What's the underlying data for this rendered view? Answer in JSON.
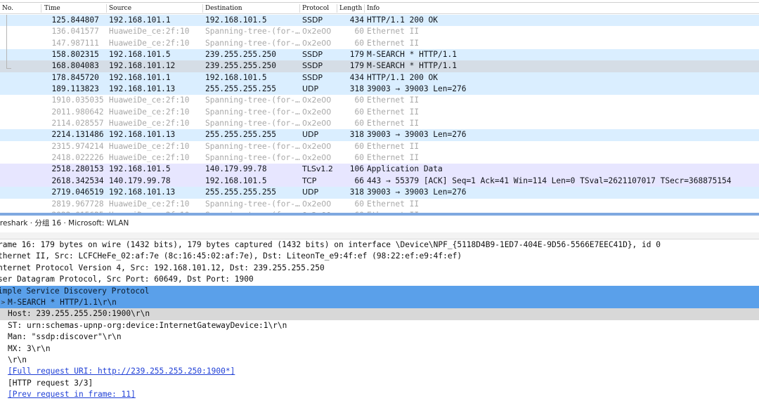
{
  "packet_list": {
    "columns": [
      "No.",
      "Time",
      "Source",
      "Destination",
      "Protocol",
      "Length",
      "Info"
    ],
    "rows": [
      {
        "no": "12",
        "time": "5.844807",
        "src": "192.168.101.1",
        "dst": "192.168.101.5",
        "proto": "SSDP",
        "len": "434",
        "info": "HTTP/1.1 200 OK",
        "kind": "udp"
      },
      {
        "no": "13",
        "time": "6.041577",
        "src": "HuaweiDe_ce:2f:10",
        "dst": "Spanning-tree-(for-…",
        "proto": "0x2e00",
        "len": "60",
        "info": "Ethernet II",
        "kind": "stp"
      },
      {
        "no": "14",
        "time": "7.987111",
        "src": "HuaweiDe_ce:2f:10",
        "dst": "Spanning-tree-(for-…",
        "proto": "0x2e00",
        "len": "60",
        "info": "Ethernet II",
        "kind": "stp"
      },
      {
        "no": "15",
        "time": "8.802315",
        "src": "192.168.101.5",
        "dst": "239.255.255.250",
        "proto": "SSDP",
        "len": "179",
        "info": "M-SEARCH * HTTP/1.1",
        "kind": "udp"
      },
      {
        "no": "16",
        "time": "8.804083",
        "src": "192.168.101.12",
        "dst": "239.255.255.250",
        "proto": "SSDP",
        "len": "179",
        "info": "M-SEARCH * HTTP/1.1",
        "kind": "selected"
      },
      {
        "no": "17",
        "time": "8.845720",
        "src": "192.168.101.1",
        "dst": "192.168.101.5",
        "proto": "SSDP",
        "len": "434",
        "info": "HTTP/1.1 200 OK",
        "kind": "udp"
      },
      {
        "no": "18",
        "time": "9.113823",
        "src": "192.168.101.13",
        "dst": "255.255.255.255",
        "proto": "UDP",
        "len": "318",
        "info": "39003 → 39003 Len=276",
        "kind": "udp"
      },
      {
        "no": "19",
        "time": "10.035035",
        "src": "HuaweiDe_ce:2f:10",
        "dst": "Spanning-tree-(for-…",
        "proto": "0x2e00",
        "len": "60",
        "info": "Ethernet II",
        "kind": "stp"
      },
      {
        "no": "20",
        "time": "11.980642",
        "src": "HuaweiDe_ce:2f:10",
        "dst": "Spanning-tree-(for-…",
        "proto": "0x2e00",
        "len": "60",
        "info": "Ethernet II",
        "kind": "stp"
      },
      {
        "no": "21",
        "time": "14.028557",
        "src": "HuaweiDe_ce:2f:10",
        "dst": "Spanning-tree-(for-…",
        "proto": "0x2e00",
        "len": "60",
        "info": "Ethernet II",
        "kind": "stp"
      },
      {
        "no": "22",
        "time": "14.131486",
        "src": "192.168.101.13",
        "dst": "255.255.255.255",
        "proto": "UDP",
        "len": "318",
        "info": "39003 → 39003 Len=276",
        "kind": "udp"
      },
      {
        "no": "23",
        "time": "15.974214",
        "src": "HuaweiDe_ce:2f:10",
        "dst": "Spanning-tree-(for-…",
        "proto": "0x2e00",
        "len": "60",
        "info": "Ethernet II",
        "kind": "stp"
      },
      {
        "no": "24",
        "time": "18.022226",
        "src": "HuaweiDe_ce:2f:10",
        "dst": "Spanning-tree-(for-…",
        "proto": "0x2e00",
        "len": "60",
        "info": "Ethernet II",
        "kind": "stp"
      },
      {
        "no": "25",
        "time": "18.280153",
        "src": "192.168.101.5",
        "dst": "140.179.99.78",
        "proto": "TLSv1.2",
        "len": "106",
        "info": "Application Data",
        "kind": "tcp"
      },
      {
        "no": "26",
        "time": "18.342534",
        "src": "140.179.99.78",
        "dst": "192.168.101.5",
        "proto": "TCP",
        "len": "66",
        "info": "443 → 55379 [ACK] Seq=1 Ack=41 Win=114 Len=0 TSval=2621107017 TSecr=368875154",
        "kind": "tcp"
      },
      {
        "no": "27",
        "time": "19.046519",
        "src": "192.168.101.13",
        "dst": "255.255.255.255",
        "proto": "UDP",
        "len": "318",
        "info": "39003 → 39003 Len=276",
        "kind": "udp"
      },
      {
        "no": "28",
        "time": "19.967728",
        "src": "HuaweiDe_ce:2f:10",
        "dst": "Spanning-tree-(for-…",
        "proto": "0x2e00",
        "len": "60",
        "info": "Ethernet II",
        "kind": "stp"
      },
      {
        "no": "29",
        "time": "22.015625",
        "src": "HuaweiDe_ce:2f:10",
        "dst": "Spanning-tree-(for-…",
        "proto": "0x2e00",
        "len": "60",
        "info": "Ethernet II",
        "kind": "stp"
      }
    ]
  },
  "detail": {
    "title": "ireshark · 分组 16 · Microsoft: WLAN",
    "lines": [
      {
        "text": "rame 16: 179 bytes on wire (1432 bits), 179 bytes captured (1432 bits) on interface \\Device\\NPF_{5118D4B9-1ED7-404E-9D56-5566E7EEC41D}, id 0",
        "level": 0,
        "style": "plain"
      },
      {
        "text": "thernet II, Src: LCFCHeFe_02:af:7e (8c:16:45:02:af:7e), Dst: LiteonTe_e9:4f:ef (98:22:ef:e9:4f:ef)",
        "level": 0,
        "style": "plain"
      },
      {
        "text": "nternet Protocol Version 4, Src: 192.168.101.12, Dst: 239.255.255.250",
        "level": 0,
        "style": "plain"
      },
      {
        "text": "ser Datagram Protocol, Src Port: 60649, Dst Port: 1900",
        "level": 0,
        "style": "plain"
      },
      {
        "text": "imple Service Discovery Protocol",
        "level": 0,
        "style": "sel-hi"
      },
      {
        "text": "M-SEARCH * HTTP/1.1\\r\\n",
        "level": 1,
        "style": "sel-hi",
        "expander": ">"
      },
      {
        "text": "Host: 239.255.255.250:1900\\r\\n",
        "level": 1,
        "style": "sel-lo"
      },
      {
        "text": "ST: urn:schemas-upnp-org:device:InternetGatewayDevice:1\\r\\n",
        "level": 1,
        "style": "plain"
      },
      {
        "text": "Man: \"ssdp:discover\"\\r\\n",
        "level": 1,
        "style": "plain"
      },
      {
        "text": "MX: 3\\r\\n",
        "level": 1,
        "style": "plain"
      },
      {
        "text": "\\r\\n",
        "level": 1,
        "style": "plain"
      },
      {
        "text": "[Full request URI: http://239.255.255.250:1900*]",
        "level": 1,
        "style": "link"
      },
      {
        "text": "[HTTP request 3/3]",
        "level": 1,
        "style": "plain"
      },
      {
        "text": "[Prev request in frame: 11]",
        "level": 1,
        "style": "link"
      }
    ]
  },
  "colors": {
    "udp_row": "#daeeff",
    "tcp_row": "#e7e6ff",
    "selected_row": "#d5dde6",
    "tree_selection": "#5aa0ea",
    "link": "#1f3fd6"
  }
}
